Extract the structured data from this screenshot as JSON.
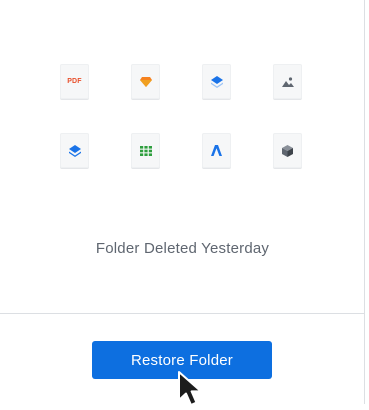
{
  "files": [
    {
      "icon": "pdf-icon",
      "label": "PDF"
    },
    {
      "icon": "sketch-icon",
      "label": ""
    },
    {
      "icon": "dropbox-paper-icon",
      "label": ""
    },
    {
      "icon": "image-icon",
      "label": ""
    },
    {
      "icon": "dropbox-icon",
      "label": ""
    },
    {
      "icon": "spreadsheet-icon",
      "label": ""
    },
    {
      "icon": "affinity-icon",
      "label": ""
    },
    {
      "icon": "3d-object-icon",
      "label": ""
    }
  ],
  "colors": {
    "pdf": "#e8502c",
    "sketch": "#f6821f",
    "blue": "#1a73e8",
    "green": "#2e9e3e",
    "gray": "#5f6670",
    "button": "#0d6fe0"
  },
  "caption": "Folder Deleted Yesterday",
  "restore_button_label": "Restore Folder"
}
